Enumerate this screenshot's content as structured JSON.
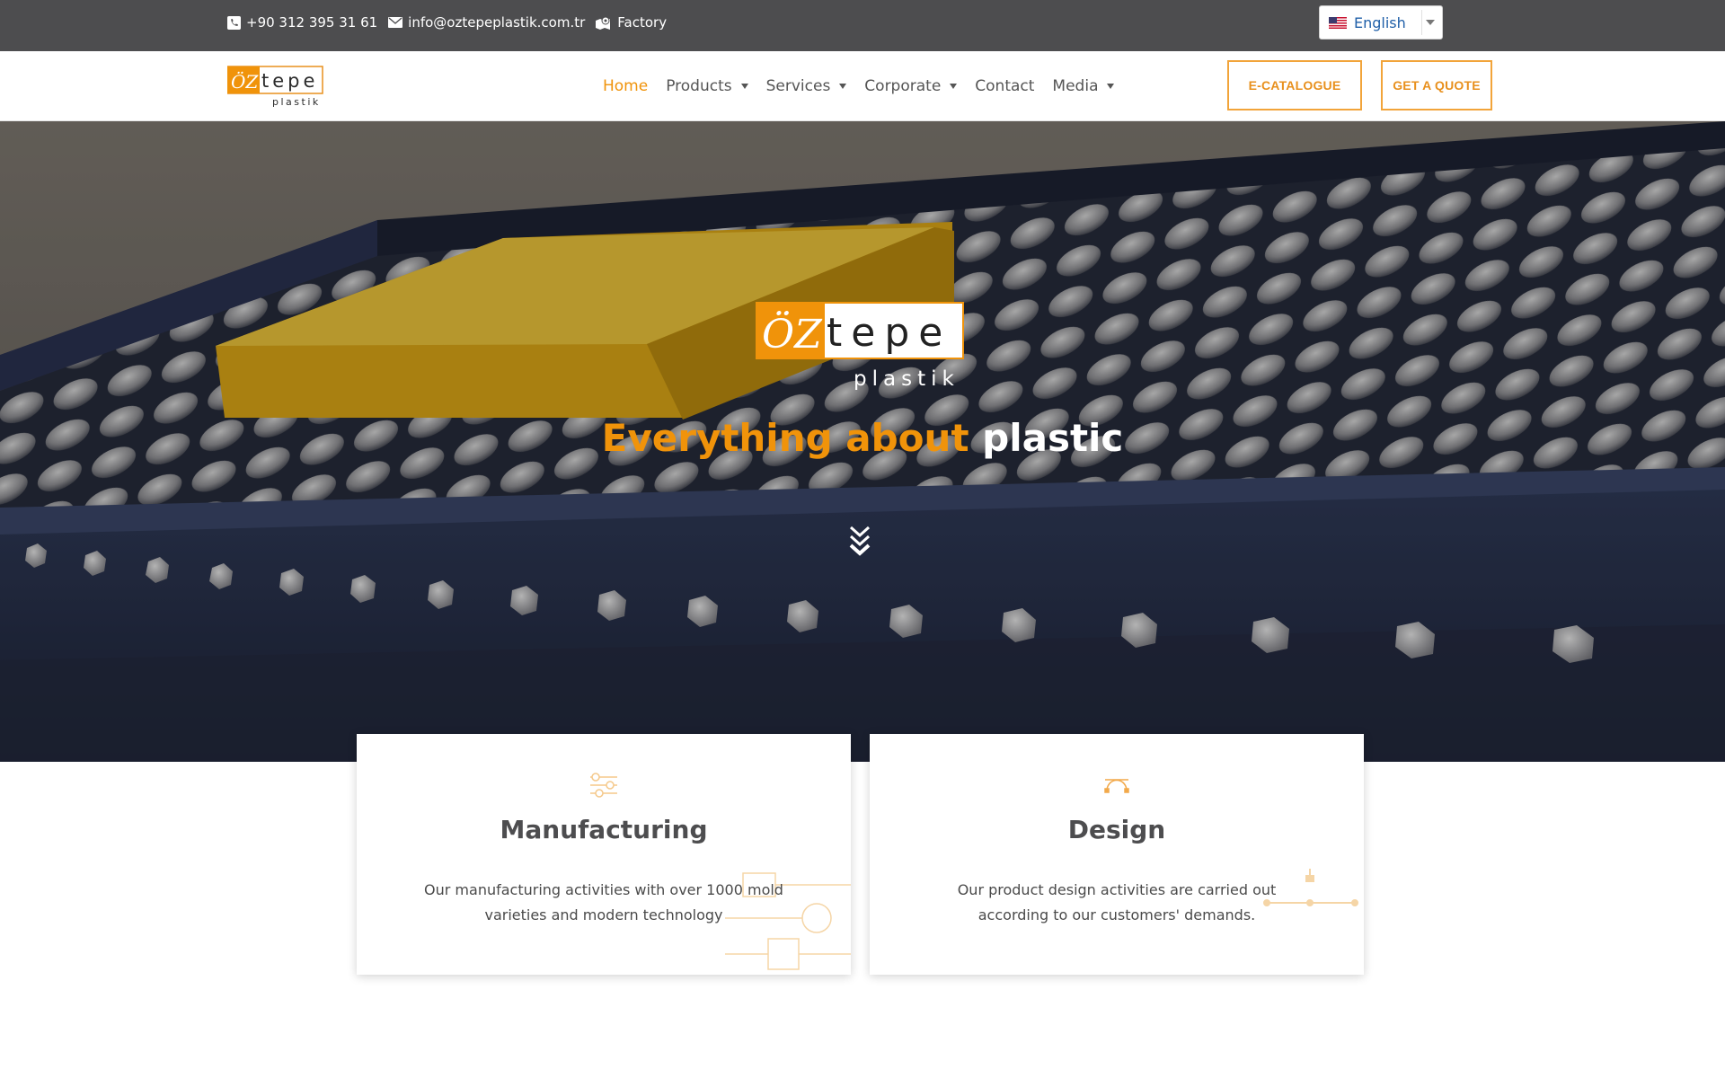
{
  "topbar": {
    "phone": "+90 312 395 31 61",
    "email": "info@oztepeplastik.com.tr",
    "factory": "Factory",
    "language": "English"
  },
  "brand": {
    "logo_main": "tepe",
    "logo_prefix": "ÖZ",
    "logo_sub": "plastik"
  },
  "nav": {
    "items": [
      {
        "label": "Home",
        "active": true,
        "has_dropdown": false
      },
      {
        "label": "Products",
        "active": false,
        "has_dropdown": true
      },
      {
        "label": "Services",
        "active": false,
        "has_dropdown": true
      },
      {
        "label": "Corporate",
        "active": false,
        "has_dropdown": true
      },
      {
        "label": "Contact",
        "active": false,
        "has_dropdown": false
      },
      {
        "label": "Media",
        "active": false,
        "has_dropdown": true
      }
    ],
    "ecatalogue": "E-CATALOGUE",
    "quote": "GET A QUOTE"
  },
  "hero": {
    "title_accent": "Everything about",
    "title_rest": "plastic"
  },
  "cards": [
    {
      "title": "Manufacturing",
      "text": "Our manufacturing activities with over 1000 mold varieties and modern technology",
      "icon": "sliders-icon"
    },
    {
      "title": "Design",
      "text": "Our product design activities are carried out according to our customers' demands.",
      "icon": "bezier-curve-icon"
    }
  ],
  "colors": {
    "accent": "#f0930a",
    "topbar": "#4d4d4f",
    "conveyor": "#2c3550"
  }
}
